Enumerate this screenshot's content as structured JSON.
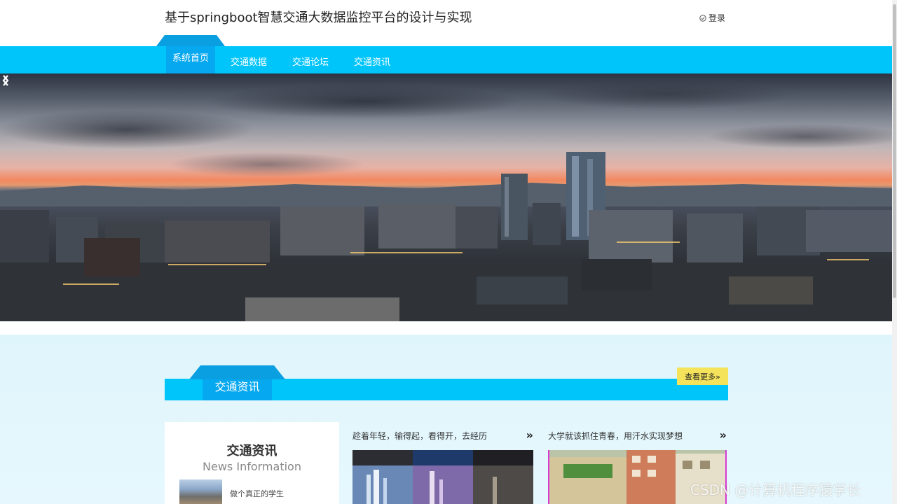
{
  "header": {
    "site_title": "基于springboot智慧交通大数据监控平台的设计与实现",
    "login_label": "登录"
  },
  "nav": {
    "items": [
      {
        "label": "系统首页",
        "active": true
      },
      {
        "label": "交通数据"
      },
      {
        "label": "交通论坛"
      },
      {
        "label": "交通资讯"
      }
    ]
  },
  "banner": {
    "prev_icon": "chevron-left-icon",
    "next_icon": "chevron-right-icon"
  },
  "section": {
    "title": "交通资讯",
    "more_label": "查看更多»"
  },
  "info_card": {
    "title": "交通资讯",
    "subtitle": "News Information",
    "item_text": "做个真正的学生"
  },
  "news": [
    {
      "title": "趁着年轻，输得起，看得开，去经历",
      "arrow": "»"
    },
    {
      "title": "大学就该抓住青春，用汗水实现梦想",
      "arrow": "»"
    }
  ],
  "watermark": "CSDN @计算机程序猿学长",
  "colors": {
    "nav_bg": "#00c5fb",
    "nav_active": "#06a8f0",
    "more_btn": "#f5e35c",
    "section_bg": "#dff5fc"
  }
}
